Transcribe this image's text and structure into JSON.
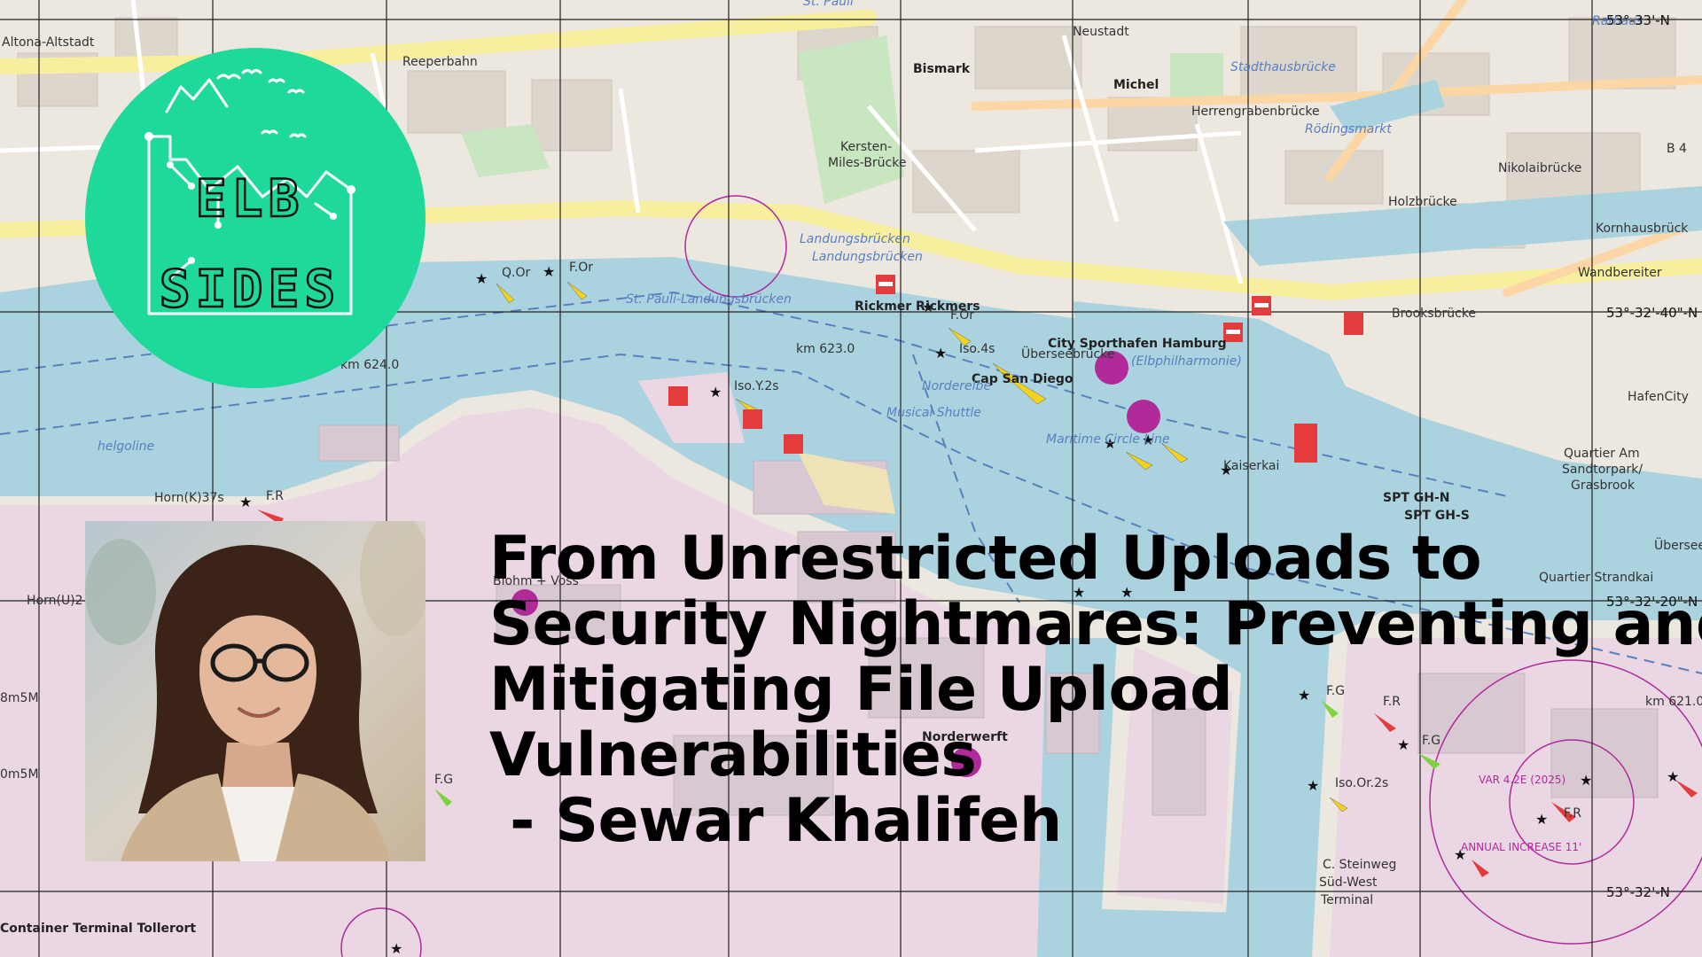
{
  "map_labels": {
    "altona": "Altona-Altstadt",
    "reeperbahn": "Reeperbahn",
    "st_pauli": "St. Pauli",
    "neustadt": "Neustadt",
    "rathaus": "Rathaus",
    "bismark": "Bismark",
    "michel": "Michel",
    "stadthausbruecke": "Stadthausbrücke",
    "rodingsmarkt": "Rödingsmarkt",
    "herrengraben": "Herrengrabenbrücke",
    "nikolaibruecke": "Nikolaibrücke",
    "holzbruecke": "Holzbrücke",
    "kornhausbruecke": "Kornhausbrück",
    "wandbereiter": "Wandbereiter",
    "brooksbruecke": "Brooksbrücke",
    "kersten": "Kersten-",
    "miles": "Miles-Brücke",
    "landungsbruecken": "Landungsbrücken",
    "landungsbruecken2": "Landungsbrücken",
    "st_pauli_landungsbruecken": "St. Pauli-Landungsbrücken",
    "rickmer": "Rickmer Rickmers",
    "city_sporthafen": "City Sporthafen Hamburg",
    "ueberseebruecke": "Überseebrücke",
    "elbphilharmonie": "(Elbphilharmonie)",
    "cap_san_diego": "Cap San Diego",
    "km623": "km 623.0",
    "km624": "km 624.0",
    "km621": "km 621.0",
    "qor": "Q.Or",
    "for": "F.Or",
    "for2": "F.Or",
    "isoy": "Iso.Y.2s",
    "iso4s": "Iso.4s",
    "horn": "Horn(K)37s",
    "fr1": "F.R",
    "hornu": "Horn(U)2",
    "helgoline": "helgoline",
    "norderelbe": "Norderelbe",
    "maritime": "Maritime Circle Line",
    "musical": "Musical Shuttle",
    "hafencity": "HafenCity",
    "quartier": "Quartier Am",
    "sandtorpark": "Sandtorpark/",
    "grasbrook": "Grasbrook",
    "kaiserkai": "Kaiserkai",
    "spt_gh_n": "SPT GH-N",
    "spt_gh_s": "SPT GH-S",
    "strandkai": "Quartier Strandkai",
    "norderwerft": "Norderwerft",
    "blohm": "Blohm + Voss",
    "fg1": "F.G",
    "fg2": "F.G",
    "fg3": "F.G",
    "fr2": "F.R",
    "fr3": "F.R",
    "isoor": "Iso.Or.2s",
    "steinweg": "C. Steinweg",
    "sued_west": "Süd-West",
    "terminal": "Terminal",
    "var": "VAR 4.2E (2025)",
    "annual": "ANNUAL INCREASE 11'",
    "container_terminal": "Container Terminal Tollerort",
    "m8": "8m5M",
    "m0": "0m5M",
    "uebersee": "Übersee",
    "b4": "B 4",
    "coord1": "53°-33'-N",
    "coord2": "53°-32'-40\"-N",
    "coord3": "53°-32'-20\"-N",
    "coord4": "53°-32'-N"
  },
  "logo": {
    "text_top": "ELB",
    "text_bottom": "SIDES",
    "bg_color": "#1fd99a"
  },
  "talk": {
    "title_lines": [
      "From Unrestricted Uploads to",
      "Security Nightmares: Preventing and",
      "Mitigating File Upload",
      "Vulnerabilities",
      " - Sewar Khalifeh"
    ]
  },
  "colors": {
    "water": "#aad3df",
    "land": "#ece7df",
    "industrial": "#ead7e3",
    "road_major": "#fcd6a4",
    "grid": "#222222",
    "harbour_blue": "#5a7fbf",
    "seamark_magenta": "#b02a9a"
  }
}
